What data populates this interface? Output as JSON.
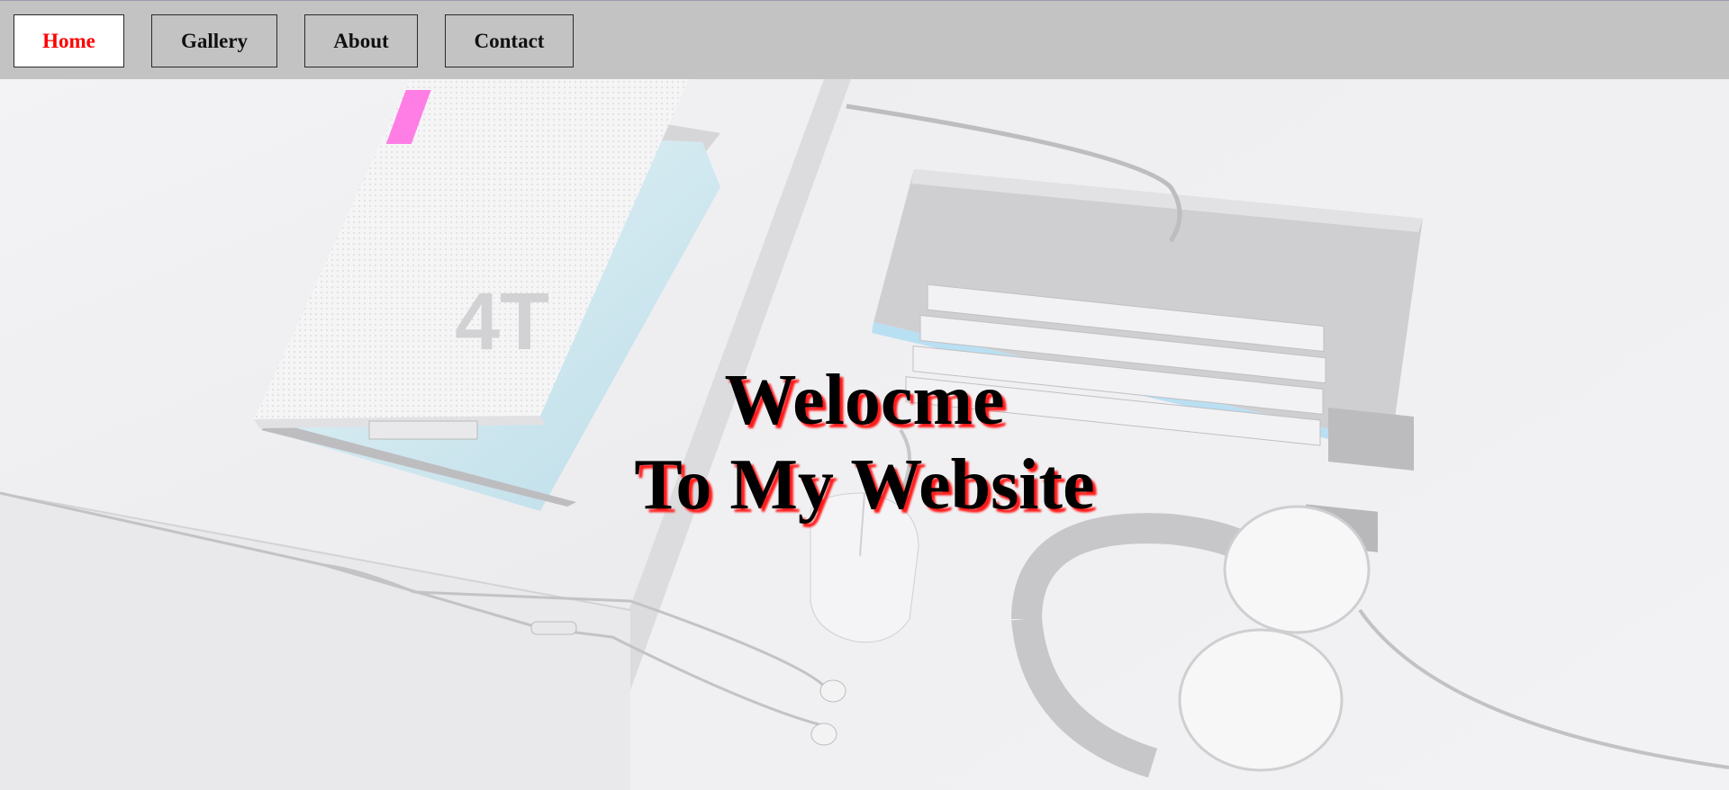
{
  "nav": {
    "items": [
      {
        "label": "Home",
        "active": true
      },
      {
        "label": "Gallery",
        "active": false
      },
      {
        "label": "About",
        "active": false
      },
      {
        "label": "Contact",
        "active": false
      }
    ]
  },
  "hero": {
    "line1": "Welocme",
    "line2": "To My Website",
    "text_color": "#000000",
    "shadow_color": "#ff1a1a"
  },
  "colors": {
    "nav_bg": "#c3c3c3",
    "active_text": "#ff0000"
  }
}
